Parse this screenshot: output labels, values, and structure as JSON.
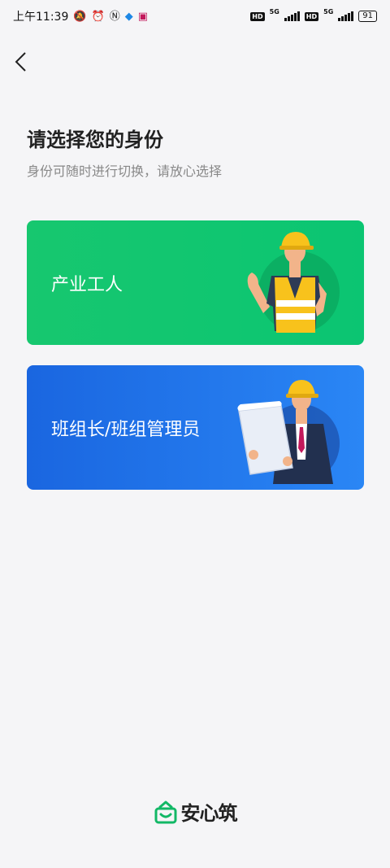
{
  "status_bar": {
    "time": "上午11:39",
    "network_1": "5G",
    "network_2": "5G",
    "battery": "91"
  },
  "header": {
    "back_icon": "chevron-left-icon"
  },
  "page": {
    "title": "请选择您的身份",
    "subtitle": "身份可随时进行切换，请放心选择"
  },
  "roles": [
    {
      "label": "产业工人",
      "color": "#12c46f"
    },
    {
      "label": "班组长/班组管理员",
      "color": "#1e73e8"
    }
  ],
  "footer": {
    "logo_text": "安心筑",
    "logo_color": "#12b866"
  }
}
